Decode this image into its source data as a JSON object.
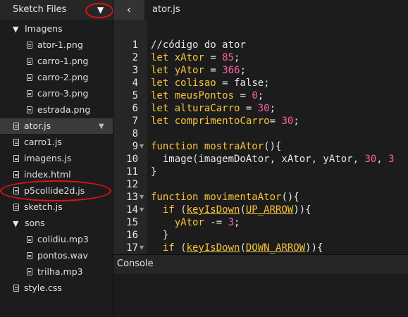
{
  "sidebar": {
    "title": "Sketch Files",
    "toggle_icon": "▼",
    "items": [
      {
        "label": "Imagens",
        "type": "folder",
        "icon": "▼"
      },
      {
        "label": "ator-1.png",
        "type": "file"
      },
      {
        "label": "carro-1.png",
        "type": "file"
      },
      {
        "label": "carro-2.png",
        "type": "file"
      },
      {
        "label": "carro-3.png",
        "type": "file"
      },
      {
        "label": "estrada.png",
        "type": "file"
      },
      {
        "label": "ator.js",
        "type": "file",
        "selected": true
      },
      {
        "label": "carro1.js",
        "type": "file"
      },
      {
        "label": "imagens.js",
        "type": "file"
      },
      {
        "label": "index.html",
        "type": "file"
      },
      {
        "label": "p5collide2d.js",
        "type": "file"
      },
      {
        "label": "sketch.js",
        "type": "file"
      },
      {
        "label": "sons",
        "type": "folder",
        "icon": "▼"
      },
      {
        "label": "colidiu.mp3",
        "type": "file"
      },
      {
        "label": "pontos.wav",
        "type": "file"
      },
      {
        "label": "trilha.mp3",
        "type": "file"
      },
      {
        "label": "style.css",
        "type": "file"
      }
    ],
    "selected_arrow": "▼"
  },
  "editor": {
    "back_icon": "‹",
    "file_name": "ator.js",
    "line_numbers": [
      "1",
      "2",
      "3",
      "4",
      "5",
      "6",
      "7",
      "8",
      "9",
      "10",
      "11",
      "12",
      "13",
      "14",
      "15",
      "16",
      "17"
    ],
    "lines": [
      "//código do ator",
      "let xAtor = 85;",
      "let yAtor = 366;",
      "let colisao = false;",
      "let meusPontos = 0;",
      "let alturaCarro = 30;",
      "let comprimentoCarro= 30;",
      "",
      "function mostraAtor(){",
      "  image(imagemDoAtor, xAtor, yAtor, 30, 3",
      "}",
      "",
      "function movimentaAtor(){",
      "  if (keyIsDown(UP_ARROW)){",
      "    yAtor -= 3;",
      "  }",
      "  if (keyIsDown(DOWN_ARROW)){"
    ]
  },
  "console": {
    "label": "Console"
  },
  "colors": {
    "keyword": "#f7c43a",
    "number": "#ff5ea8",
    "annotation": "#e21111"
  }
}
